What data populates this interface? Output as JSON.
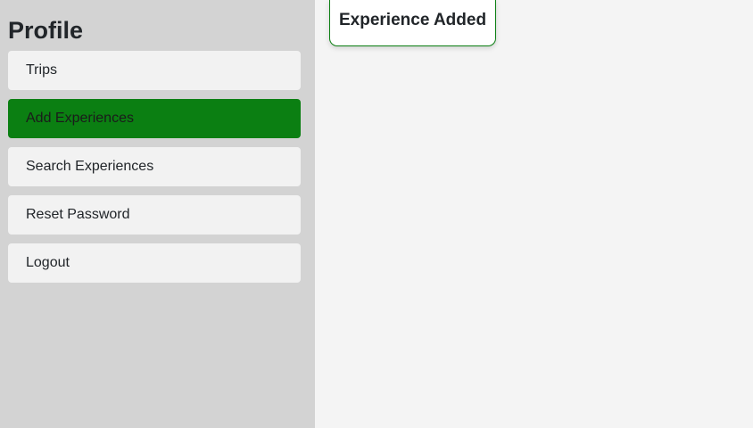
{
  "sidebar": {
    "title": "Profile",
    "items": [
      {
        "label": "Trips",
        "active": false
      },
      {
        "label": "Add Experiences",
        "active": true
      },
      {
        "label": "Search Experiences",
        "active": false
      },
      {
        "label": "Reset Password",
        "active": false
      },
      {
        "label": "Logout",
        "active": false
      }
    ]
  },
  "toast": {
    "message": "Experience Added"
  },
  "colors": {
    "sidebar_bg": "#d3d3d3",
    "main_bg": "#f4f4f4",
    "accent": "#0b7f12",
    "nav_item_bg": "#f2f2f2"
  }
}
